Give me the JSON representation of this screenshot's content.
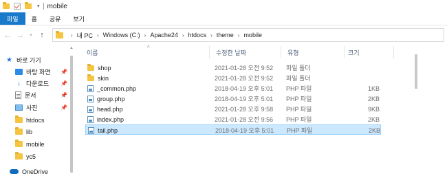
{
  "window": {
    "title": "mobile",
    "qat_arrow": "▾"
  },
  "ribbon": {
    "tabs": [
      {
        "label": "파일",
        "active": true
      },
      {
        "label": "홈",
        "active": false
      },
      {
        "label": "공유",
        "active": false
      },
      {
        "label": "보기",
        "active": false
      }
    ]
  },
  "nav": {
    "back": "←",
    "forward": "→",
    "recent": "▾",
    "up": "↑"
  },
  "address": {
    "crumbs": [
      "내 PC",
      "Windows (C:)",
      "Apache24",
      "htdocs",
      "theme",
      "mobile"
    ],
    "separator": "›",
    "lead_separator": "›"
  },
  "sidebar": {
    "items": [
      {
        "label": "바로 가기",
        "icon": "star-icon",
        "pinned": false
      },
      {
        "label": "바탕 화면",
        "icon": "desktop-icon",
        "pinned": true
      },
      {
        "label": "다운로드",
        "icon": "download-icon",
        "pinned": true
      },
      {
        "label": "문서",
        "icon": "document-icon",
        "pinned": true
      },
      {
        "label": "사진",
        "icon": "pictures-icon",
        "pinned": true
      },
      {
        "label": "htdocs",
        "icon": "folder-icon",
        "pinned": false
      },
      {
        "label": "lib",
        "icon": "folder-icon",
        "pinned": false
      },
      {
        "label": "mobile",
        "icon": "folder-icon",
        "pinned": false
      },
      {
        "label": "yc5",
        "icon": "folder-icon",
        "pinned": false
      },
      {
        "label": "OneDrive",
        "icon": "onedrive-cloud-icon",
        "pinned": false
      }
    ],
    "pin_glyph": "📌"
  },
  "columns": {
    "name": "이름",
    "date": "수정한 날짜",
    "type": "유형",
    "size": "크기",
    "sort_indicator": "^"
  },
  "files": [
    {
      "name": "shop",
      "date": "2021-01-28 오전 9:52",
      "type": "파일 폴더",
      "size": "",
      "kind": "folder"
    },
    {
      "name": "skin",
      "date": "2021-01-28 오전 9:52",
      "type": "파일 폴더",
      "size": "",
      "kind": "folder"
    },
    {
      "name": "_common.php",
      "date": "2018-04-19 오후 5:01",
      "type": "PHP 파일",
      "size": "1KB",
      "kind": "php"
    },
    {
      "name": "group.php",
      "date": "2018-04-19 오후 5:01",
      "type": "PHP 파일",
      "size": "2KB",
      "kind": "php"
    },
    {
      "name": "head.php",
      "date": "2021-01-28 오후 9:58",
      "type": "PHP 파일",
      "size": "9KB",
      "kind": "php"
    },
    {
      "name": "index.php",
      "date": "2021-01-28 오전 9:56",
      "type": "PHP 파일",
      "size": "2KB",
      "kind": "php"
    },
    {
      "name": "tail.php",
      "date": "2018-04-19 오후 5:01",
      "type": "PHP 파일",
      "size": "2KB",
      "kind": "php",
      "selected": true
    }
  ],
  "colors": {
    "accent": "#1979ca",
    "selection": "#cce8ff",
    "folder": "#f5c542"
  }
}
